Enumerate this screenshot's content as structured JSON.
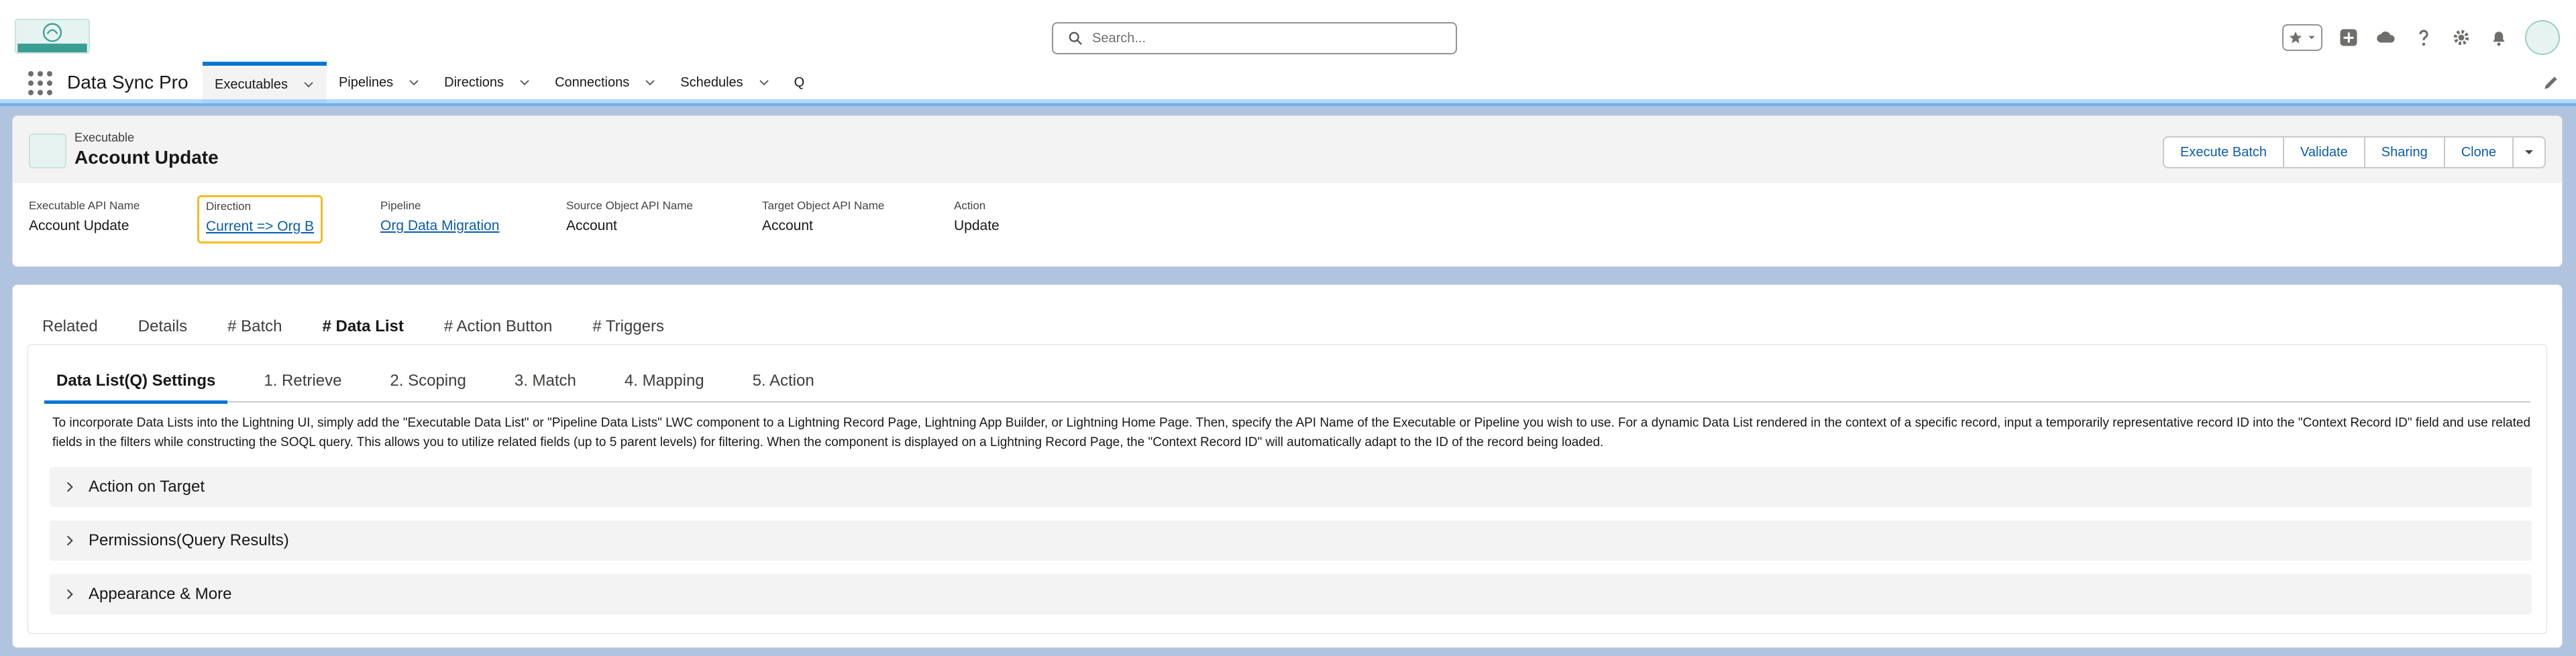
{
  "header": {
    "search_placeholder": "Search..."
  },
  "nav": {
    "app_name": "Data Sync Pro",
    "items": [
      {
        "label": "Executables",
        "active": true
      },
      {
        "label": "Pipelines"
      },
      {
        "label": "Directions"
      },
      {
        "label": "Connections"
      },
      {
        "label": "Schedules"
      },
      {
        "label": "Q"
      }
    ]
  },
  "record": {
    "type": "Executable",
    "title": "Account Update",
    "actions": [
      "Execute Batch",
      "Validate",
      "Sharing",
      "Clone"
    ],
    "fields": [
      {
        "label": "Executable API Name",
        "value": "Account Update"
      },
      {
        "label": "Direction",
        "value": "Current => Org B"
      },
      {
        "label": "Pipeline",
        "value": "Org Data Migration"
      },
      {
        "label": "Source Object API Name",
        "value": "Account"
      },
      {
        "label": "Target Object API Name",
        "value": "Account"
      },
      {
        "label": "Action",
        "value": "Update"
      }
    ]
  },
  "main_tabs": [
    "Related",
    "Details",
    "# Batch",
    "# Data List",
    "# Action Button",
    "# Triggers"
  ],
  "main_tab_active": "# Data List",
  "sub_tabs": [
    "Data List(Q) Settings",
    "1. Retrieve",
    "2. Scoping",
    "3. Match",
    "4. Mapping",
    "5. Action"
  ],
  "sub_tab_active": "Data List(Q) Settings",
  "description": "To incorporate Data Lists into the Lightning UI, simply add the \"Executable Data List\" or \"Pipeline Data Lists\" LWC component to a Lightning Record Page, Lightning App Builder, or Lightning Home Page. Then, specify the API Name of the Executable or Pipeline you wish to use. For a dynamic Data List rendered in the context of a specific record, input a temporarily representative record ID into the \"Context Record ID\" field and use related fields in the filters while constructing the SOQL query. This allows you to utilize related fields (up to 5 parent levels) for filtering. When the component is displayed on a Lightning Record Page, the \"Context Record ID\" will automatically adapt to the ID of the record being loaded.",
  "sections": [
    "Action on Target",
    "Permissions(Query Results)",
    "Appearance & More"
  ],
  "icons": {
    "search": "search-icon",
    "favorites": "star-icon",
    "add": "plus-icon",
    "trailhead": "cloud-icon",
    "help": "question-icon",
    "setup": "gear-icon",
    "notifications": "bell-icon",
    "edit_nav": "pencil-icon"
  },
  "colors": {
    "brand": "#0176d3",
    "link": "#0b5cab",
    "highlight": "#f4bc25",
    "page_bg": "#b0c4df"
  }
}
